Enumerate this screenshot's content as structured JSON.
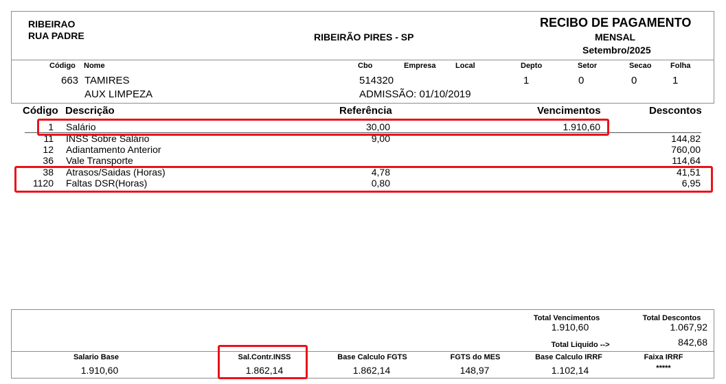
{
  "header": {
    "company_line1": "RIBEIRAO",
    "company_line2": "RUA PADRE",
    "city": "RIBEIRÃO PIRES - SP",
    "doc_title": "RECIBO DE PAGAMENTO",
    "period_type": "MENSAL",
    "period": "Setembro/2025"
  },
  "employee_header": {
    "codigo": "Código",
    "nome": "Nome",
    "cbo": "Cbo",
    "empresa": "Empresa",
    "local": "Local",
    "depto": "Depto",
    "setor": "Setor",
    "secao": "Secao",
    "folha": "Folha"
  },
  "employee": {
    "codigo": "663",
    "nome": "TAMIRES",
    "cargo": "AUX LIMPEZA",
    "cbo": "514320",
    "admissao": "ADMISSÃO: 01/10/2019",
    "depto": "1",
    "setor": "0",
    "secao": "0",
    "folha": "1"
  },
  "items_header": {
    "codigo": "Código",
    "descricao": "Descrição",
    "referencia": "Referência",
    "vencimentos": "Vencimentos",
    "descontos": "Descontos"
  },
  "items": [
    {
      "codigo": "1",
      "descricao": "Salário",
      "referencia": "30,00",
      "vencimentos": "1.910,60",
      "descontos": ""
    },
    {
      "codigo": "11",
      "descricao": "INSS Sobre Salário",
      "referencia": "9,00",
      "vencimentos": "",
      "descontos": "144,82"
    },
    {
      "codigo": "12",
      "descricao": "Adiantamento Anterior",
      "referencia": "",
      "vencimentos": "",
      "descontos": "760,00"
    },
    {
      "codigo": "36",
      "descricao": "Vale Transporte",
      "referencia": "",
      "vencimentos": "",
      "descontos": "114,64"
    },
    {
      "codigo": "38",
      "descricao": "Atrasos/Saidas (Horas)",
      "referencia": "4,78",
      "vencimentos": "",
      "descontos": "41,51"
    },
    {
      "codigo": "1120",
      "descricao": "Faltas DSR(Horas)",
      "referencia": "0,80",
      "vencimentos": "",
      "descontos": "6,95"
    }
  ],
  "totals": {
    "total_vencimentos_label": "Total Vencimentos",
    "total_vencimentos": "1.910,60",
    "total_descontos_label": "Total Descontos",
    "total_descontos": "1.067,92",
    "total_liquido_label": "Total Liquido -->",
    "total_liquido": "842,68"
  },
  "footer": {
    "salario_base_label": "Salario Base",
    "salario_base": "1.910,60",
    "sal_contr_inss_label": "Sal.Contr.INSS",
    "sal_contr_inss": "1.862,14",
    "base_fgts_label": "Base Calculo FGTS",
    "base_fgts": "1.862,14",
    "fgts_mes_label": "FGTS do MES",
    "fgts_mes": "148,97",
    "base_irrf_label": "Base Calculo IRRF",
    "base_irrf": "1.102,14",
    "faixa_irrf_label": "Faixa IRRF",
    "faixa_irrf": "*****"
  },
  "highlight_color": "#e8121a"
}
